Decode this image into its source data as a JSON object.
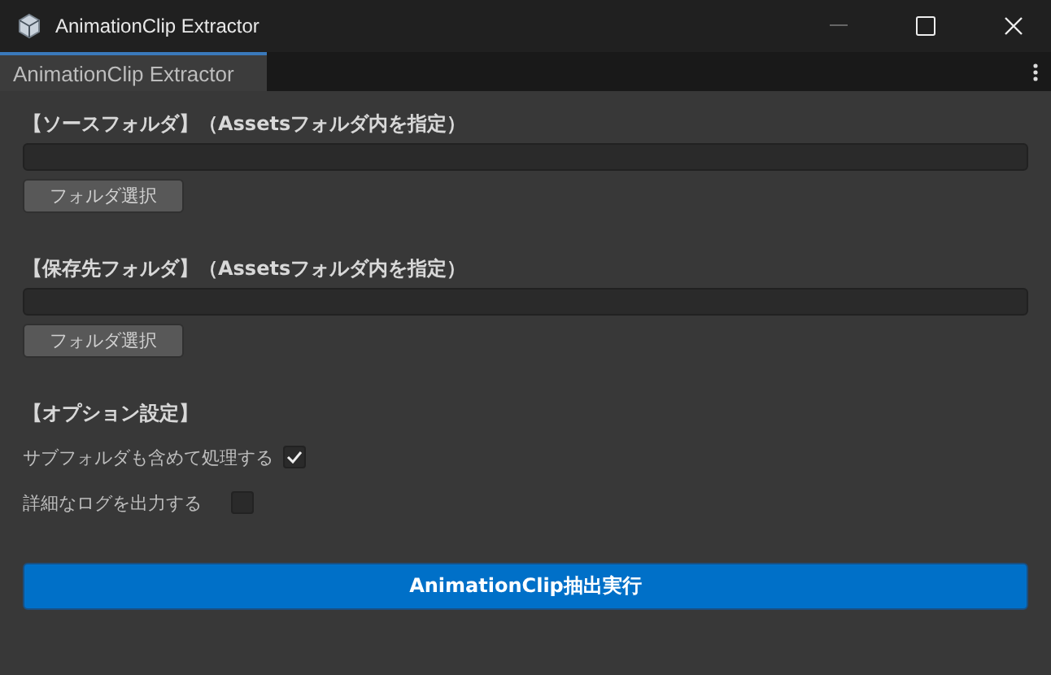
{
  "window": {
    "title": "AnimationClip Extractor"
  },
  "tabs": [
    {
      "label": "AnimationClip Extractor",
      "selected": true
    }
  ],
  "sections": [
    {
      "heading": "【ソースフォルダ】（Assetsフォルダ内を指定）",
      "button": "フォルダ選択"
    },
    {
      "heading": "【保存先フォルダ】（Assetsフォルダ内を指定）",
      "button": "フォルダ選択"
    }
  ],
  "options": {
    "heading": "【オプション設定】",
    "items": [
      {
        "label": "サブフォルダも含めて処理する",
        "checked": true
      },
      {
        "label": "詳細なログを出力する",
        "checked": false
      }
    ]
  },
  "run_button": "AnimationClip抽出実行"
}
